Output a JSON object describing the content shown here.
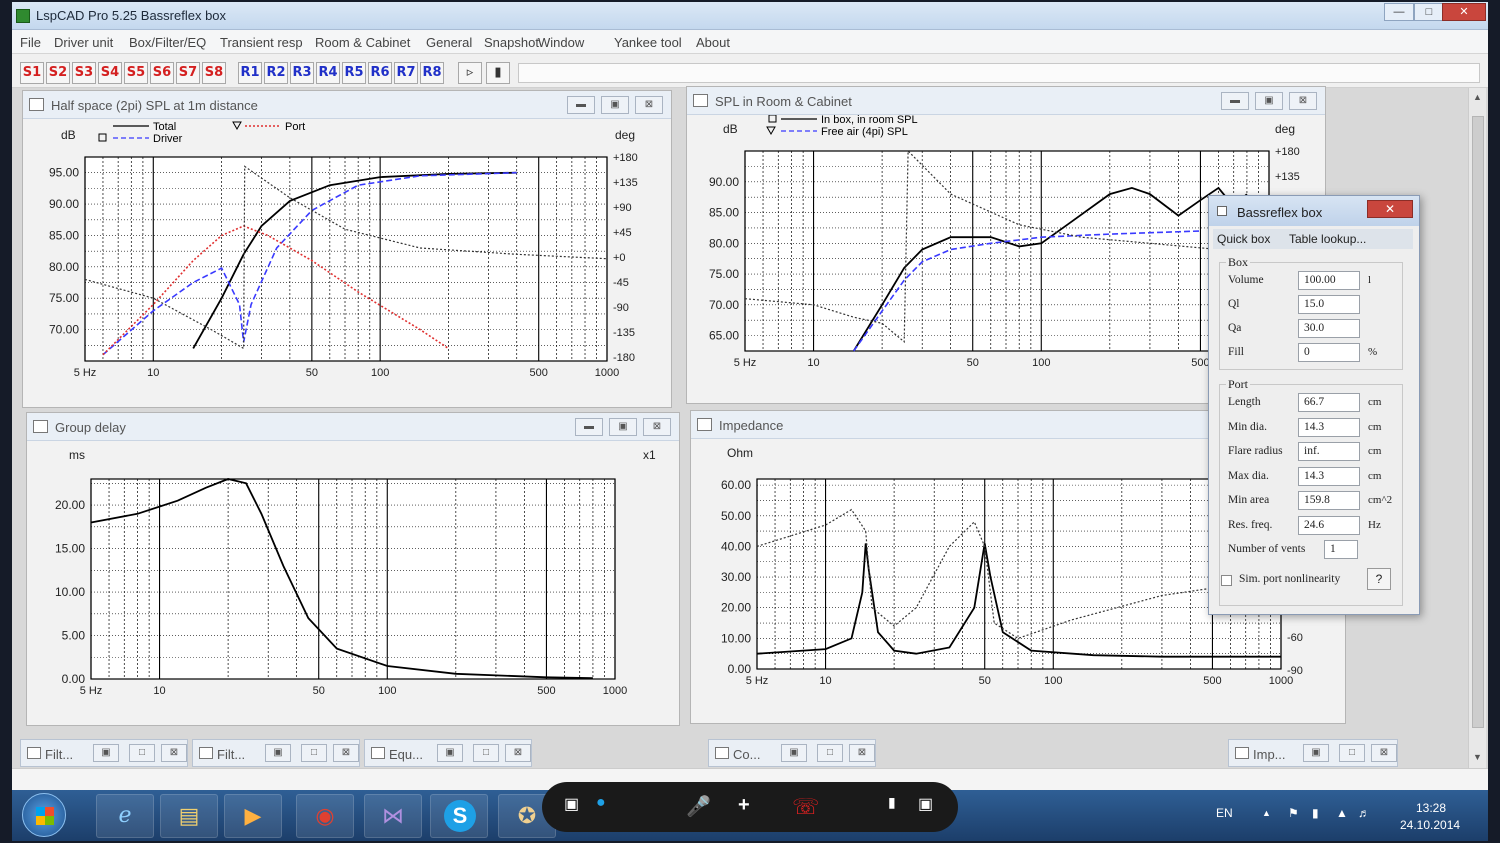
{
  "app": {
    "title": "LspCAD Pro 5.25 Bassreflex box"
  },
  "menu": [
    "File",
    "Driver unit",
    "Box/Filter/EQ",
    "Transient resp",
    "Room & Cabinet",
    "General",
    "Snapshot",
    "Window",
    "Yankee tool",
    "About"
  ],
  "toolbar": {
    "s_buttons": [
      "S1",
      "S2",
      "S3",
      "S4",
      "S5",
      "S6",
      "S7",
      "S8"
    ],
    "r_buttons": [
      "R1",
      "R2",
      "R3",
      "R4",
      "R5",
      "R6",
      "R7",
      "R8"
    ]
  },
  "colors": {
    "s_label": "#d42020",
    "r_label": "#2030c8",
    "driver_curve": "#3a3aff",
    "port_curve": "#e03030"
  },
  "win_spl": {
    "title": "Half space (2pi) SPL at 1m distance",
    "legend_total": "Total",
    "legend_driver": "Driver",
    "legend_port": "Port",
    "y_unit": "dB",
    "y2_unit": "deg",
    "y_ticks": [
      "95.00",
      "90.00",
      "85.00",
      "80.00",
      "75.00",
      "70.00"
    ],
    "y2_ticks": [
      "+180",
      "+135",
      "+90",
      "+45",
      "+0",
      "-45",
      "-90",
      "-135",
      "-180"
    ],
    "x_ticks": [
      "5 Hz",
      "10",
      "50",
      "100",
      "500",
      "1000"
    ]
  },
  "win_room": {
    "title": "SPL in Room & Cabinet",
    "legend_inbox": "In box, in room SPL",
    "legend_freeair": "Free air (4pi) SPL",
    "y_unit": "dB",
    "y2_unit": "deg",
    "y_ticks": [
      "90.00",
      "85.00",
      "80.00",
      "75.00",
      "70.00",
      "65.00"
    ],
    "y2_ticks": [
      "+180",
      "+135"
    ],
    "x_ticks": [
      "5 Hz",
      "10",
      "50",
      "100",
      "500"
    ]
  },
  "win_gd": {
    "title": "Group delay",
    "y_unit": "ms",
    "scale": "x1",
    "y_ticks": [
      "20.00",
      "15.00",
      "10.00",
      "5.00",
      "0.00"
    ],
    "x_ticks": [
      "5 Hz",
      "10",
      "50",
      "100",
      "500",
      "1000"
    ]
  },
  "win_imp": {
    "title": "Impedance",
    "y_unit": "Ohm",
    "y_ticks": [
      "60.00",
      "50.00",
      "40.00",
      "30.00",
      "20.00",
      "10.00",
      "0.00"
    ],
    "y2_ticks": [
      "-60",
      "-90"
    ],
    "x_ticks": [
      "5 Hz",
      "10",
      "50",
      "100",
      "500",
      "1000"
    ]
  },
  "dialog": {
    "title": "Bassreflex box",
    "tab_quick": "Quick box",
    "tab_table": "Table lookup...",
    "box_group": "Box",
    "box_fields": [
      {
        "label": "Volume",
        "value": "100.00",
        "unit": "l"
      },
      {
        "label": "Ql",
        "value": "15.0",
        "unit": ""
      },
      {
        "label": "Qa",
        "value": "30.0",
        "unit": ""
      },
      {
        "label": "Fill",
        "value": "0",
        "unit": "%"
      }
    ],
    "port_group": "Port",
    "port_fields": [
      {
        "label": "Length",
        "value": "66.7",
        "unit": "cm"
      },
      {
        "label": "Min dia.",
        "value": "14.3",
        "unit": "cm"
      },
      {
        "label": "Flare radius",
        "value": "inf.",
        "unit": "cm"
      },
      {
        "label": "Max dia.",
        "value": "14.3",
        "unit": "cm"
      },
      {
        "label": "Min area",
        "value": "159.8",
        "unit": "cm^2"
      },
      {
        "label": "Res. freq.",
        "value": "24.6",
        "unit": "Hz"
      }
    ],
    "vents_label": "Number of vents",
    "vents_value": "1",
    "sim_label": "Sim. port nonlinearity",
    "help_label": "?"
  },
  "minimized": [
    "Filt...",
    "Filt...",
    "Equ...",
    "Co...",
    "Imp..."
  ],
  "callbar": {
    "add": "+"
  },
  "tray": {
    "lang": "EN",
    "time": "13:28",
    "date": "24.10.2014"
  }
}
